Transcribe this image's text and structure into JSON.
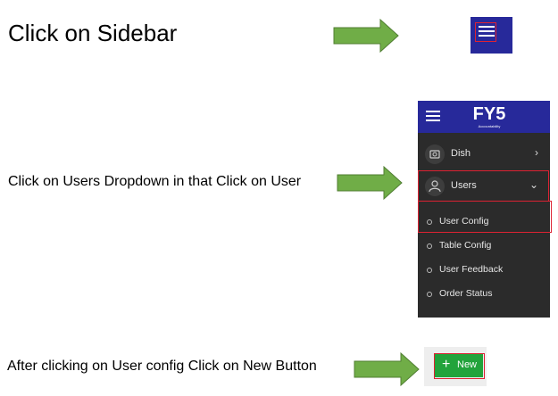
{
  "steps": [
    {
      "text": "Click on Sidebar"
    },
    {
      "text": "Click on Users Dropdown in that Click on User"
    },
    {
      "text": "After clicking on User config Click on New Button"
    }
  ],
  "icons": {
    "hamburger": "menu-icon",
    "dish": "dish-icon",
    "users": "user-icon",
    "arrow": "right-arrow-icon"
  },
  "sidebar": {
    "logo": {
      "text": "FY5",
      "tagline": "Accountability"
    },
    "items": [
      {
        "label": "Dish",
        "chevron": "›"
      },
      {
        "label": "Users",
        "chevron": "⌄"
      }
    ],
    "subitems": [
      {
        "label": "User Config"
      },
      {
        "label": "Table Config"
      },
      {
        "label": "User Feedback"
      },
      {
        "label": "Order Status"
      }
    ]
  },
  "new_button": {
    "plus": "+",
    "label": "New"
  },
  "colors": {
    "arrow_green": "#70ad47",
    "header_blue": "#27299a",
    "sidebar_bg": "#2b2b2b",
    "highlight_red": "#dd2233",
    "button_green": "#22a33b"
  }
}
